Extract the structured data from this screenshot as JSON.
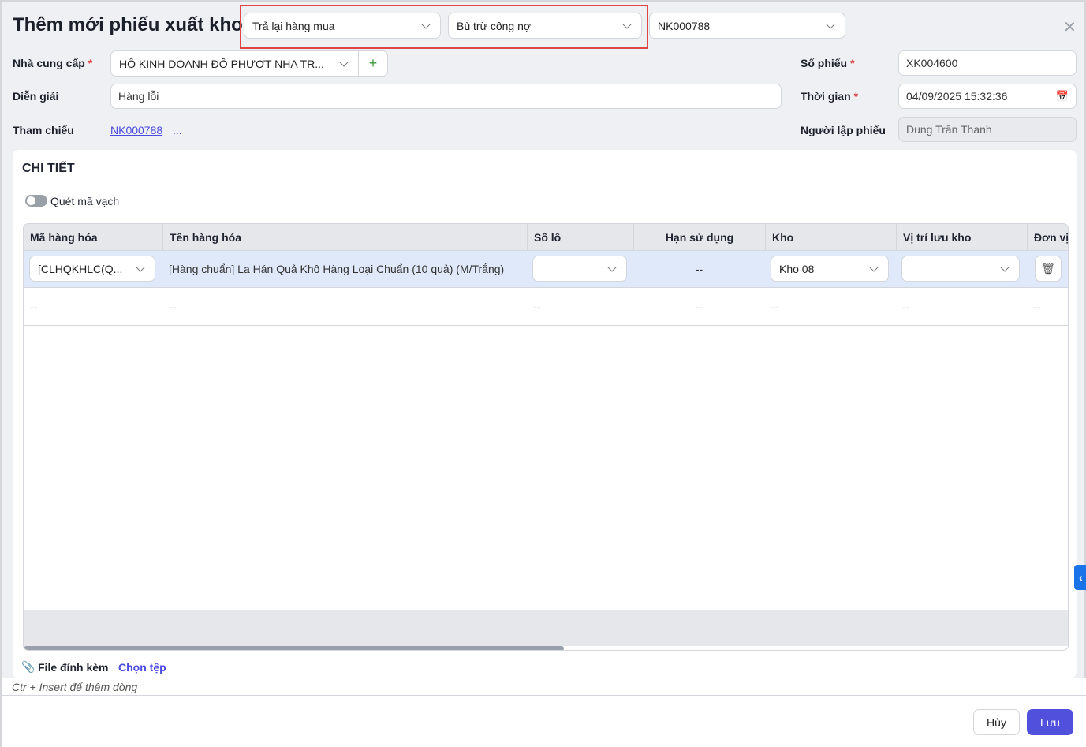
{
  "header": {
    "title": "Thêm mới phiếu xuất kho",
    "type_select": "Trả lại hàng mua",
    "payment_select": "Bù trừ công nợ",
    "ref_select": "NK000788",
    "close_icon": "close-icon"
  },
  "form": {
    "supplier_label": "Nhà cung cấp",
    "supplier_value": "HỘ KINH DOANH ĐÔ PHƯỢT NHA TR...",
    "add_label": "+",
    "desc_label": "Diễn giải",
    "desc_value": "Hàng lỗi",
    "ref_label": "Tham chiếu",
    "ref_link": "NK000788",
    "ref_more": "...",
    "number_label": "Số phiếu",
    "number_value": "XK004600",
    "time_label": "Thời gian",
    "time_value": "04/09/2025 15:32:36",
    "creator_label": "Người lập phiếu",
    "creator_value": "Dung Trần Thanh",
    "required": "*"
  },
  "detail": {
    "title": "CHI TIẾT",
    "barcode_label": "Quét mã vạch",
    "barcode_on": false,
    "columns": [
      "Mã hàng hóa",
      "Tên hàng hóa",
      "Số lô",
      "Hạn sử dụng",
      "Kho",
      "Vị trí lưu kho",
      "Đơn vị"
    ],
    "row1": {
      "code": "[CLHQKHLC(Q...",
      "name": "[Hàng chuẩn] La Hán Quả Khô Hàng Loại Chuẩn (10 quả) (M/Trắng)",
      "lot": "",
      "expiry": "--",
      "warehouse": "Kho 08",
      "location": ""
    },
    "row2": [
      "--",
      "--",
      "--",
      "--",
      "--",
      "--",
      "--"
    ],
    "attach_label": "File đính kèm",
    "choose_file": "Chọn tệp"
  },
  "hint": "Ctr + Insert để thêm dòng",
  "footer": {
    "cancel": "Hủy",
    "save": "Lưu"
  },
  "colors": {
    "primary": "#5050dc",
    "link": "#4a4ae0",
    "required": "#e04444",
    "highlight": "#e04444"
  }
}
